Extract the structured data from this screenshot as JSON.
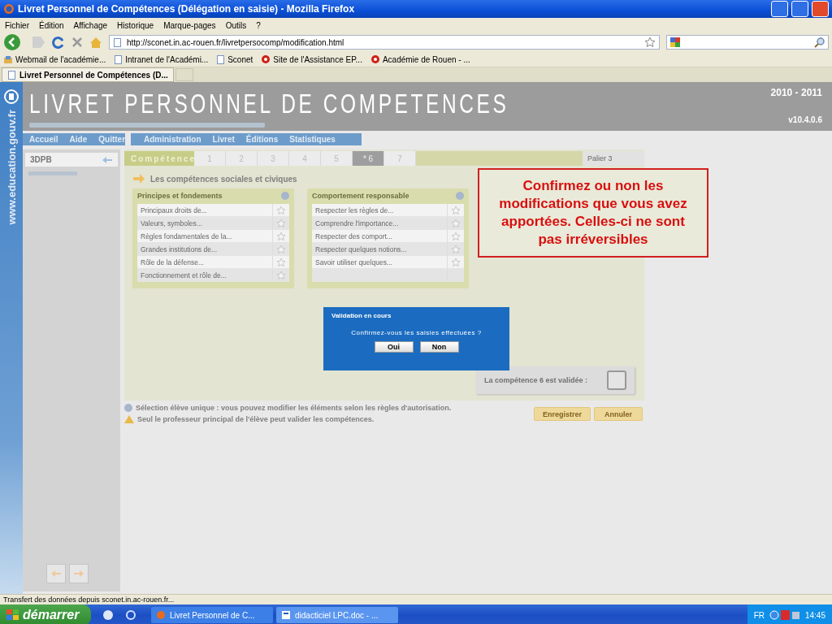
{
  "window": {
    "title": "Livret Personnel de Compétences (Délégation en saisie) - Mozilla Firefox"
  },
  "menu": [
    "Fichier",
    "Édition",
    "Affichage",
    "Historique",
    "Marque-pages",
    "Outils",
    "?"
  ],
  "address_bar": {
    "value": "http://sconet.in.ac-rouen.fr/livretpersocomp/modification.html"
  },
  "bookmarks": [
    {
      "kind": "mail",
      "label": "Webmail de l'académie..."
    },
    {
      "kind": "page",
      "label": "Intranet de l'Académi..."
    },
    {
      "kind": "page",
      "label": "Sconet"
    },
    {
      "kind": "site",
      "label": "Site de l'Assistance EP..."
    },
    {
      "kind": "site",
      "label": "Académie de Rouen - ..."
    }
  ],
  "tabs": [
    {
      "label": "Livret Personnel de Compétences (D...",
      "selected": true
    }
  ],
  "app": {
    "side_label": "www.education.gouv.fr",
    "title": "LIVRET PERSONNEL DE COMPETENCES",
    "year": "2010 - 2011",
    "version": "v10.4.0.6",
    "left_menu": [
      "Accueil",
      "Aide",
      "Quitter"
    ],
    "main_menu": [
      "Administration",
      "Livret",
      "Éditions",
      "Statistiques"
    ],
    "class_name": "3DPB",
    "competence_label": "Compétence",
    "competence_tabs": [
      {
        "label": "1",
        "selected": false
      },
      {
        "label": "2",
        "selected": false
      },
      {
        "label": "3",
        "selected": false
      },
      {
        "label": "4",
        "selected": false
      },
      {
        "label": "5",
        "selected": false
      },
      {
        "label": "* 6",
        "selected": true
      },
      {
        "label": "7",
        "selected": false
      }
    ],
    "level_select": "Palier 3",
    "section_title": "Les compétences sociales et civiques",
    "groups": [
      {
        "title": "Principes et fondements",
        "items": [
          "Principaux droits de...",
          "Valeurs, symboles...",
          "Règles fondamentales de la...",
          "Grandes institutions de...",
          "Rôle de la défense...",
          "Fonctionnement et rôle de..."
        ]
      },
      {
        "title": "Comportement responsable",
        "items": [
          "Respecter les règles de...",
          "Comprendre l'importance...",
          "Respecter des comport...",
          "Respecter quelques notions...",
          "Savoir utiliser quelques..."
        ]
      }
    ],
    "validation": {
      "label": "La compétence 6 est validée :",
      "checked": false
    },
    "notes": [
      {
        "kind": "info",
        "text": "Sélection élève unique : vous pouvez modifier les éléments selon les règles d'autorisation."
      },
      {
        "kind": "warning",
        "text": "Seul le professeur principal de l'élève peut valider les compétences."
      }
    ],
    "buttons": [
      "Enregistrer",
      "Annuler"
    ]
  },
  "dialog": {
    "title": "Validation en cours",
    "message": "Confirmez-vous les saisies effectuées ?",
    "buttons": [
      "Oui",
      "Non"
    ]
  },
  "annotation": "Confirmez ou non les modifications que vous avez apportées. Celles-ci ne sont pas irréversibles",
  "status_bar": "Transfert des données depuis sconet.in.ac-rouen.fr...",
  "taskbar": {
    "start": "démarrer",
    "windows": [
      {
        "label": "Livret Personnel de C...",
        "selected": false
      },
      {
        "label": "didacticiel LPC.doc - ...",
        "selected": true
      }
    ],
    "language": "FR",
    "clock": "14:45"
  }
}
